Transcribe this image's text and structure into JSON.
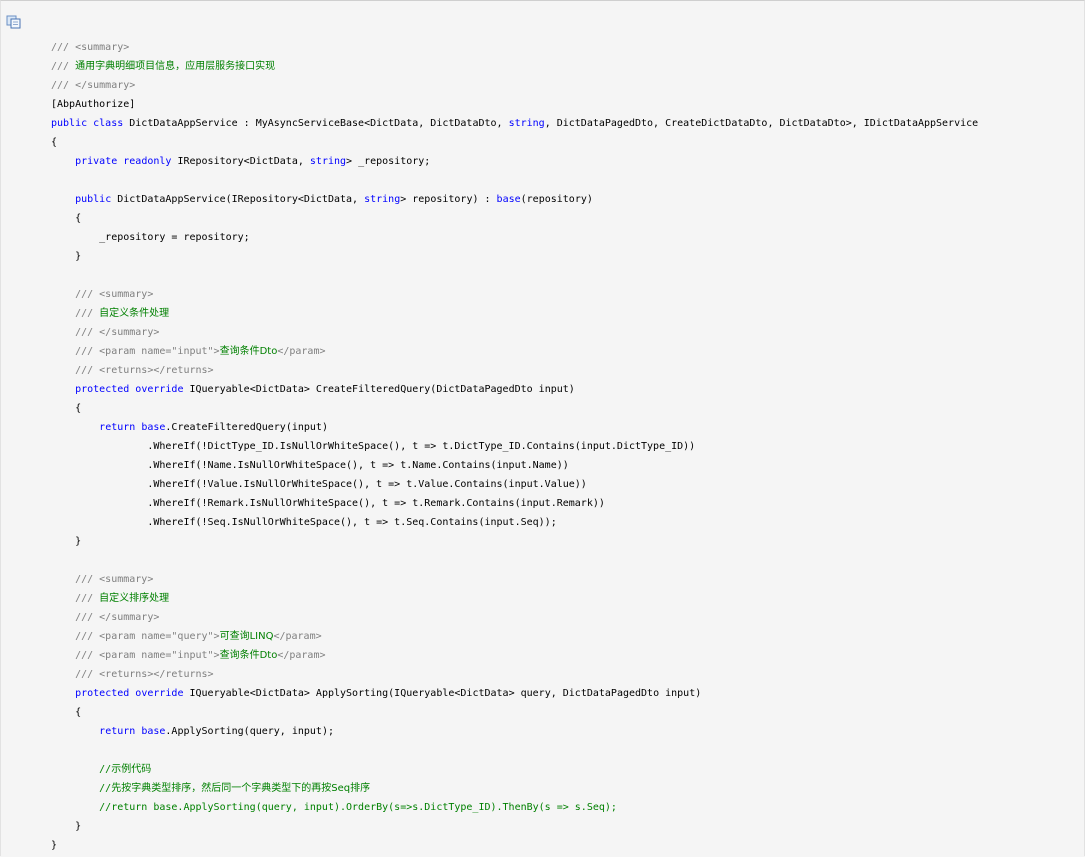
{
  "toolbar": {
    "copy_icon": "copy-icon"
  },
  "colors": {
    "plain": "#000000",
    "doc_comment": "#808080",
    "comment_text": "#008000",
    "keyword": "#0000ff",
    "background": "#f5f5f5"
  },
  "code": {
    "lines": [
      [
        [
          "t-cmt",
          "/// <summary>"
        ]
      ],
      [
        [
          "t-cmt",
          "/// "
        ],
        [
          "t-green t-cn",
          "通用字典明细项目信息，应用层服务接口实现"
        ]
      ],
      [
        [
          "t-cmt",
          "/// </summary>"
        ]
      ],
      [
        [
          "t-plain",
          "[AbpAuthorize]"
        ]
      ],
      [
        [
          "t-kw",
          "public class"
        ],
        [
          "t-plain",
          " DictDataAppService : MyAsyncServiceBase<DictData, DictDataDto, "
        ],
        [
          "t-kw",
          "string"
        ],
        [
          "t-plain",
          ", DictDataPagedDto, CreateDictDataDto, DictDataDto>, IDictDataAppService"
        ]
      ],
      [
        [
          "t-plain",
          "{"
        ]
      ],
      [
        [
          "t-plain",
          "    "
        ],
        [
          "t-kw",
          "private readonly"
        ],
        [
          "t-plain",
          " IRepository<DictData, "
        ],
        [
          "t-kw",
          "string"
        ],
        [
          "t-plain",
          "> _repository;"
        ]
      ],
      [
        [
          "t-plain",
          ""
        ]
      ],
      [
        [
          "t-plain",
          "    "
        ],
        [
          "t-kw",
          "public"
        ],
        [
          "t-plain",
          " DictDataAppService(IRepository<DictData, "
        ],
        [
          "t-kw",
          "string"
        ],
        [
          "t-plain",
          "> repository) : "
        ],
        [
          "t-kw",
          "base"
        ],
        [
          "t-plain",
          "(repository)"
        ]
      ],
      [
        [
          "t-plain",
          "    {"
        ]
      ],
      [
        [
          "t-plain",
          "        _repository = repository;"
        ]
      ],
      [
        [
          "t-plain",
          "    }"
        ]
      ],
      [
        [
          "t-plain",
          ""
        ]
      ],
      [
        [
          "t-cmt",
          "    /// <summary>"
        ]
      ],
      [
        [
          "t-cmt",
          "    /// "
        ],
        [
          "t-green t-cn",
          "自定义条件处理"
        ]
      ],
      [
        [
          "t-cmt",
          "    /// </summary>"
        ]
      ],
      [
        [
          "t-cmt",
          "    /// <param name=\"input\">"
        ],
        [
          "t-green t-cn",
          "查询条件Dto"
        ],
        [
          "t-cmt",
          "</param>"
        ]
      ],
      [
        [
          "t-cmt",
          "    /// <returns></returns>"
        ]
      ],
      [
        [
          "t-plain",
          "    "
        ],
        [
          "t-kw",
          "protected override"
        ],
        [
          "t-plain",
          " IQueryable<DictData> CreateFilteredQuery(DictDataPagedDto input)"
        ]
      ],
      [
        [
          "t-plain",
          "    {"
        ]
      ],
      [
        [
          "t-plain",
          "        "
        ],
        [
          "t-kw",
          "return base"
        ],
        [
          "t-plain",
          ".CreateFilteredQuery(input)"
        ]
      ],
      [
        [
          "t-plain",
          "                .WhereIf(!DictType_ID.IsNullOrWhiteSpace(), t => t.DictType_ID.Contains(input.DictType_ID))"
        ]
      ],
      [
        [
          "t-plain",
          "                .WhereIf(!Name.IsNullOrWhiteSpace(), t => t.Name.Contains(input.Name))"
        ]
      ],
      [
        [
          "t-plain",
          "                .WhereIf(!Value.IsNullOrWhiteSpace(), t => t.Value.Contains(input.Value))"
        ]
      ],
      [
        [
          "t-plain",
          "                .WhereIf(!Remark.IsNullOrWhiteSpace(), t => t.Remark.Contains(input.Remark))"
        ]
      ],
      [
        [
          "t-plain",
          "                .WhereIf(!Seq.IsNullOrWhiteSpace(), t => t.Seq.Contains(input.Seq));"
        ]
      ],
      [
        [
          "t-plain",
          "    }"
        ]
      ],
      [
        [
          "t-plain",
          ""
        ]
      ],
      [
        [
          "t-cmt",
          "    /// <summary>"
        ]
      ],
      [
        [
          "t-cmt",
          "    /// "
        ],
        [
          "t-green t-cn",
          "自定义排序处理"
        ]
      ],
      [
        [
          "t-cmt",
          "    /// </summary>"
        ]
      ],
      [
        [
          "t-cmt",
          "    /// <param name=\"query\">"
        ],
        [
          "t-green t-cn",
          "可查询LINQ"
        ],
        [
          "t-cmt",
          "</param>"
        ]
      ],
      [
        [
          "t-cmt",
          "    /// <param name=\"input\">"
        ],
        [
          "t-green t-cn",
          "查询条件Dto"
        ],
        [
          "t-cmt",
          "</param>"
        ]
      ],
      [
        [
          "t-cmt",
          "    /// <returns></returns>"
        ]
      ],
      [
        [
          "t-plain",
          "    "
        ],
        [
          "t-kw",
          "protected override"
        ],
        [
          "t-plain",
          " IQueryable<DictData> ApplySorting(IQueryable<DictData> query, DictDataPagedDto input)"
        ]
      ],
      [
        [
          "t-plain",
          "    {"
        ]
      ],
      [
        [
          "t-plain",
          "        "
        ],
        [
          "t-kw",
          "return base"
        ],
        [
          "t-plain",
          ".ApplySorting(query, input);"
        ]
      ],
      [
        [
          "t-plain",
          ""
        ]
      ],
      [
        [
          "t-green",
          "        //"
        ],
        [
          "t-green t-cn",
          "示例代码"
        ]
      ],
      [
        [
          "t-green",
          "        //"
        ],
        [
          "t-green t-cn",
          "先按字典类型排序，然后同一个字典类型下的再按Seq排序"
        ]
      ],
      [
        [
          "t-green",
          "        //return base.ApplySorting(query, input).OrderBy(s=>s.DictType_ID).ThenBy(s => s.Seq);"
        ]
      ],
      [
        [
          "t-plain",
          "    }"
        ]
      ],
      [
        [
          "t-plain",
          "}"
        ]
      ]
    ]
  }
}
